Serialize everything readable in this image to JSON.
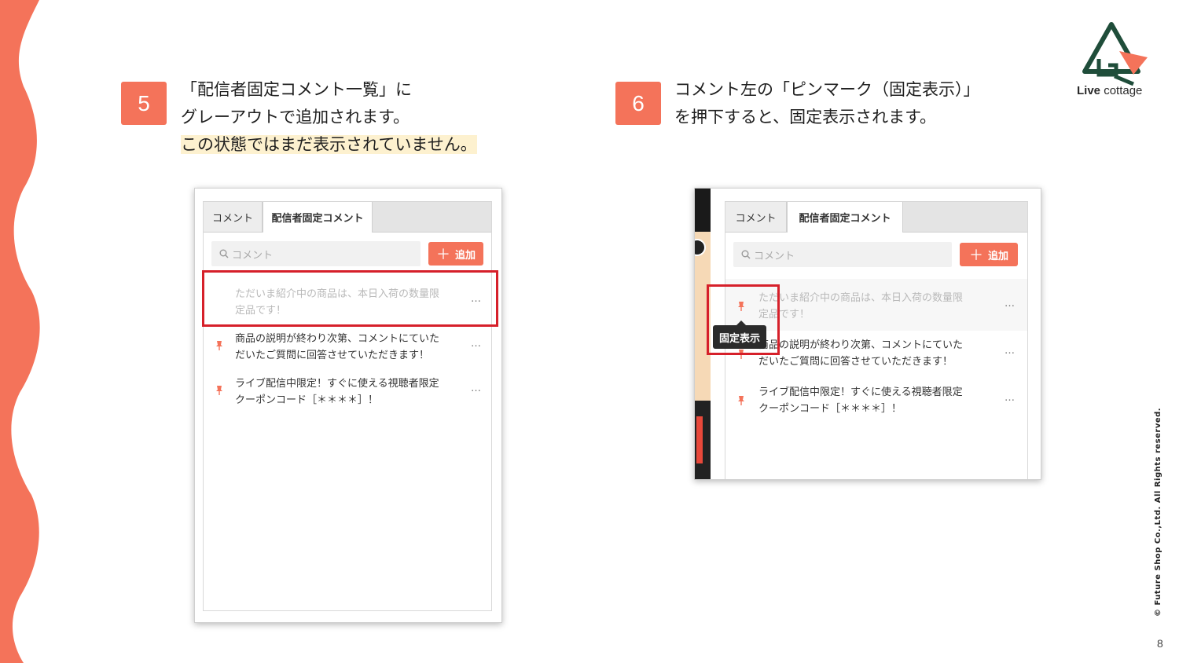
{
  "brand": {
    "logo_text_bold": "Live",
    "logo_text": "cottage",
    "accent": "#f4735a"
  },
  "copyright": "© Future Shop Co.,Ltd. All Rights reserved.",
  "page_number": "8",
  "step5": {
    "number": "5",
    "lines": [
      "「配信者固定コメント一覧」に",
      "グレーアウトで追加されます。"
    ],
    "highlight": "この状態ではまだ表示されていません。"
  },
  "step6": {
    "number": "6",
    "lines": [
      "コメント左の「ピンマーク（固定表示）」",
      "を押下すると、固定表示されます。"
    ]
  },
  "panel": {
    "tabs": [
      "コメント",
      "配信者固定コメント"
    ],
    "search_placeholder": "コメント",
    "add_plus": "＋",
    "add_label": "追加",
    "more": "…",
    "comments": [
      {
        "line1": "ただいま紹介中の商品は、本日入荷の数量限",
        "line2": "定品です！"
      },
      {
        "line1": "商品の説明が終わり次第、コメントにていた",
        "line2": "だいたご質問に回答させていただきます！"
      },
      {
        "line1": "ライブ配信中限定！すぐに使える視聴者限定",
        "line2": "クーポンコード［＊＊＊＊］！"
      }
    ]
  },
  "tooltip": "固定表示"
}
